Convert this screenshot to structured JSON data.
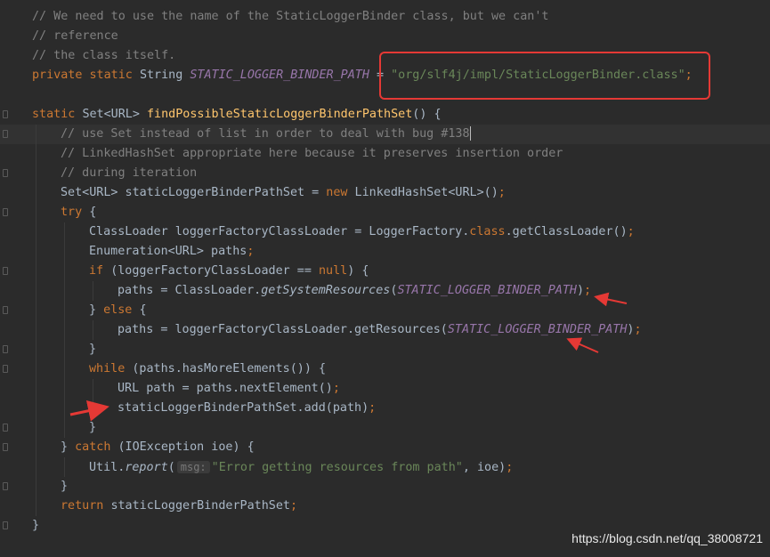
{
  "editor": {
    "current_line": 7,
    "lines": [
      {
        "tokens": [
          {
            "t": "// We need to use the name of the StaticLoggerBinder class, but we can't",
            "c": "comment"
          }
        ],
        "fold": false,
        "indent": 0
      },
      {
        "tokens": [
          {
            "t": "// reference",
            "c": "comment"
          }
        ],
        "fold": false,
        "indent": 0
      },
      {
        "tokens": [
          {
            "t": "// the class itself.",
            "c": "comment"
          }
        ],
        "fold": false,
        "indent": 0
      },
      {
        "tokens": [
          {
            "t": "private ",
            "c": "keyword"
          },
          {
            "t": "static ",
            "c": "keyword"
          },
          {
            "t": "String ",
            "c": "default"
          },
          {
            "t": "STATIC_LOGGER_BINDER_PATH",
            "c": "const"
          },
          {
            "t": " = ",
            "c": "default"
          },
          {
            "t": "\"org/slf4j/impl/StaticLoggerBinder.class\"",
            "c": "string"
          },
          {
            "t": ";",
            "c": "keyword"
          }
        ],
        "fold": false,
        "indent": 0
      },
      {
        "tokens": [],
        "fold": false,
        "indent": 0
      },
      {
        "tokens": [
          {
            "t": "static ",
            "c": "keyword"
          },
          {
            "t": "Set<URL> ",
            "c": "default"
          },
          {
            "t": "findPossibleStaticLoggerBinderPathSet",
            "c": "method"
          },
          {
            "t": "() {",
            "c": "default"
          }
        ],
        "fold": true,
        "indent": 0
      },
      {
        "tokens": [
          {
            "t": "// use Set instead of list in order to deal with bug #138",
            "c": "comment"
          }
        ],
        "fold": true,
        "indent": 1,
        "caret": true
      },
      {
        "tokens": [
          {
            "t": "// LinkedHashSet appropriate here because it preserves insertion order",
            "c": "comment"
          }
        ],
        "fold": false,
        "indent": 1
      },
      {
        "tokens": [
          {
            "t": "// during iteration",
            "c": "comment"
          }
        ],
        "fold": true,
        "indent": 1
      },
      {
        "tokens": [
          {
            "t": "Set<URL> staticLoggerBinderPathSet = ",
            "c": "default"
          },
          {
            "t": "new ",
            "c": "keyword"
          },
          {
            "t": "LinkedHashSet<URL>()",
            "c": "default"
          },
          {
            "t": ";",
            "c": "keyword"
          }
        ],
        "fold": false,
        "indent": 1
      },
      {
        "tokens": [
          {
            "t": "try ",
            "c": "keyword"
          },
          {
            "t": "{",
            "c": "default"
          }
        ],
        "fold": true,
        "indent": 1
      },
      {
        "tokens": [
          {
            "t": "ClassLoader loggerFactoryClassLoader = LoggerFactory.",
            "c": "default"
          },
          {
            "t": "class",
            "c": "keyword"
          },
          {
            "t": ".getClassLoader()",
            "c": "default"
          },
          {
            "t": ";",
            "c": "keyword"
          }
        ],
        "fold": false,
        "indent": 2
      },
      {
        "tokens": [
          {
            "t": "Enumeration<URL> paths",
            "c": "default"
          },
          {
            "t": ";",
            "c": "keyword"
          }
        ],
        "fold": false,
        "indent": 2
      },
      {
        "tokens": [
          {
            "t": "if ",
            "c": "keyword"
          },
          {
            "t": "(loggerFactoryClassLoader == ",
            "c": "default"
          },
          {
            "t": "null",
            "c": "keyword"
          },
          {
            "t": ") {",
            "c": "default"
          }
        ],
        "fold": true,
        "indent": 2
      },
      {
        "tokens": [
          {
            "t": "paths = ClassLoader.",
            "c": "default"
          },
          {
            "t": "getSystemResources",
            "c": "static"
          },
          {
            "t": "(",
            "c": "default"
          },
          {
            "t": "STATIC_LOGGER_BINDER_PATH",
            "c": "const"
          },
          {
            "t": ")",
            "c": "default"
          },
          {
            "t": ";",
            "c": "keyword"
          }
        ],
        "fold": false,
        "indent": 3
      },
      {
        "tokens": [
          {
            "t": "} ",
            "c": "default"
          },
          {
            "t": "else ",
            "c": "keyword"
          },
          {
            "t": "{",
            "c": "default"
          }
        ],
        "fold": true,
        "indent": 2
      },
      {
        "tokens": [
          {
            "t": "paths = loggerFactoryClassLoader.getResources(",
            "c": "default"
          },
          {
            "t": "STATIC_LOGGER_BINDER_PATH",
            "c": "const"
          },
          {
            "t": ")",
            "c": "default"
          },
          {
            "t": ";",
            "c": "keyword"
          }
        ],
        "fold": false,
        "indent": 3
      },
      {
        "tokens": [
          {
            "t": "}",
            "c": "default"
          }
        ],
        "fold": true,
        "indent": 2
      },
      {
        "tokens": [
          {
            "t": "while ",
            "c": "keyword"
          },
          {
            "t": "(paths.hasMoreElements()) {",
            "c": "default"
          }
        ],
        "fold": true,
        "indent": 2
      },
      {
        "tokens": [
          {
            "t": "URL path = paths.nextElement()",
            "c": "default"
          },
          {
            "t": ";",
            "c": "keyword"
          }
        ],
        "fold": false,
        "indent": 3
      },
      {
        "tokens": [
          {
            "t": "staticLoggerBinderPathSet.add(path)",
            "c": "default"
          },
          {
            "t": ";",
            "c": "keyword"
          }
        ],
        "fold": false,
        "indent": 3
      },
      {
        "tokens": [
          {
            "t": "}",
            "c": "default"
          }
        ],
        "fold": true,
        "indent": 2
      },
      {
        "tokens": [
          {
            "t": "} ",
            "c": "default"
          },
          {
            "t": "catch ",
            "c": "keyword"
          },
          {
            "t": "(IOException ioe) {",
            "c": "default"
          }
        ],
        "fold": true,
        "indent": 1
      },
      {
        "tokens": [
          {
            "t": "Util.",
            "c": "default"
          },
          {
            "t": "report",
            "c": "static"
          },
          {
            "t": "(",
            "c": "default"
          },
          {
            "t": "msg:",
            "c": "hint"
          },
          {
            "t": "\"Error getting resources from path\"",
            "c": "string"
          },
          {
            "t": ", ioe)",
            "c": "default"
          },
          {
            "t": ";",
            "c": "keyword"
          }
        ],
        "fold": false,
        "indent": 2
      },
      {
        "tokens": [
          {
            "t": "}",
            "c": "default"
          }
        ],
        "fold": true,
        "indent": 1
      },
      {
        "tokens": [
          {
            "t": "return ",
            "c": "keyword"
          },
          {
            "t": "staticLoggerBinderPathSet",
            "c": "default"
          },
          {
            "t": ";",
            "c": "keyword"
          }
        ],
        "fold": false,
        "indent": 1
      },
      {
        "tokens": [
          {
            "t": "}",
            "c": "default"
          }
        ],
        "fold": true,
        "indent": 0
      }
    ]
  },
  "annotations": {
    "box_color": "#e53935",
    "arrow_color": "#e53935"
  },
  "watermark": "https://blog.csdn.net/qq_38008721",
  "colors": {
    "background": "#2b2b2b",
    "comment": "#808080",
    "keyword": "#cc7832",
    "string": "#6a8759",
    "constant": "#9876aa",
    "method": "#ffc66d",
    "default": "#a9b7c6"
  }
}
